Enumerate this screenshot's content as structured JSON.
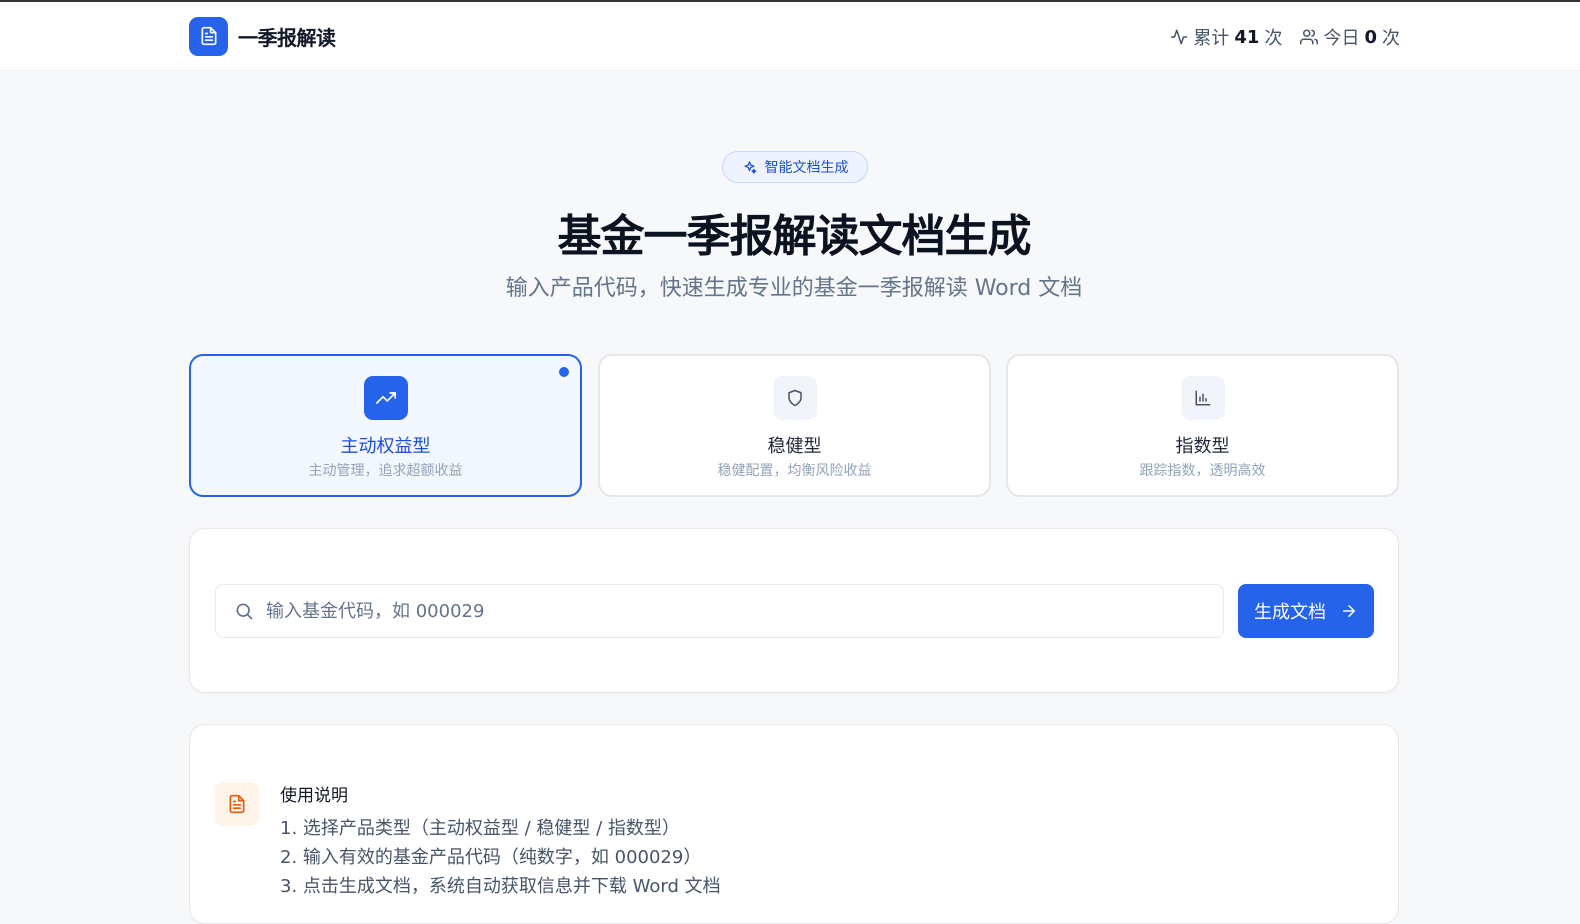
{
  "header": {
    "app_title": "一季报解读",
    "stats": [
      {
        "label": "累计",
        "value": "41",
        "unit": "次",
        "icon": "activity-icon"
      },
      {
        "label": "今日",
        "value": "0",
        "unit": "次",
        "icon": "users-icon"
      }
    ]
  },
  "hero": {
    "badge": "智能文档生成",
    "title": "基金一季报解读文档生成",
    "subtitle": "输入产品代码，快速生成专业的基金一季报解读 Word 文档"
  },
  "product_types": [
    {
      "name": "主动权益型",
      "desc": "主动管理，追求超额收益",
      "icon": "trending-up-icon",
      "selected": true
    },
    {
      "name": "稳健型",
      "desc": "稳健配置，均衡风险收益",
      "icon": "shield-icon",
      "selected": false
    },
    {
      "name": "指数型",
      "desc": "跟踪指数，透明高效",
      "icon": "bar-chart-icon",
      "selected": false
    }
  ],
  "search": {
    "placeholder": "输入基金代码，如 000029",
    "value": "",
    "button_label": "生成文档"
  },
  "instructions": {
    "title": "使用说明",
    "items": [
      "1. 选择产品类型（主动权益型 / 稳健型 / 指数型）",
      "2. 输入有效的基金产品代码（纯数字，如 000029）",
      "3. 点击生成文档，系统自动获取信息并下载 Word 文档"
    ]
  },
  "colors": {
    "accent": "#2563eb",
    "background": "#f7f8fa",
    "help_icon": "#ea580c"
  }
}
